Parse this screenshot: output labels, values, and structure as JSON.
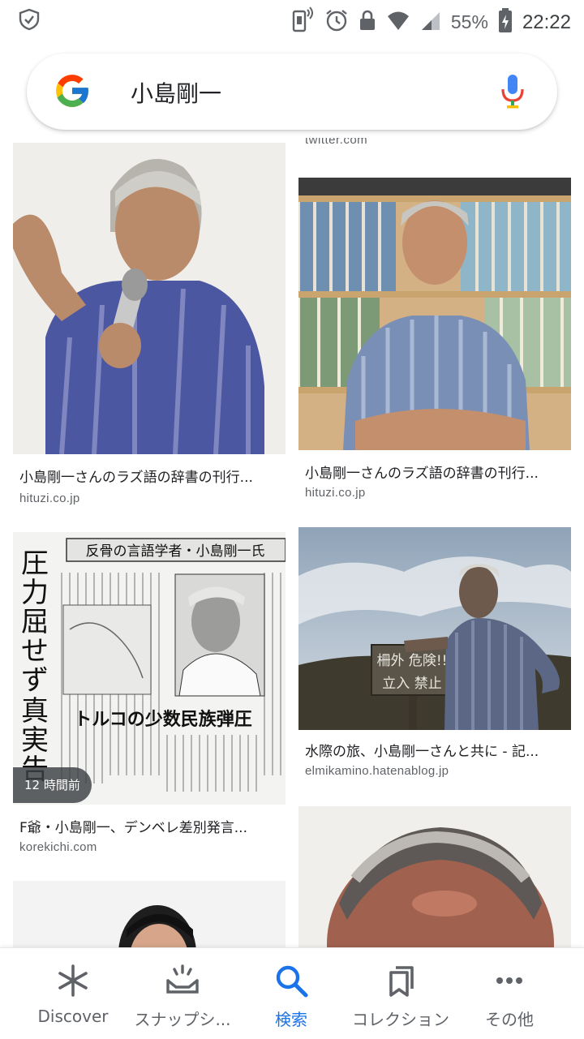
{
  "status_bar": {
    "battery_percent": "55%",
    "time": "22:22"
  },
  "search": {
    "query": "小島剛一"
  },
  "results": {
    "cut_domain": "twitter.com",
    "items": [
      {
        "title": "小島剛一さんのラズ語の辞書の刊行...",
        "domain": "hituzi.co.jp"
      },
      {
        "title": "小島剛一さんのラズ語の辞書の刊行...",
        "domain": "hituzi.co.jp"
      },
      {
        "title": "F爺・小島剛一、デンベレ差別発言...",
        "domain": "korekichi.com",
        "badge": "12 時間前"
      },
      {
        "title": "水際の旅、小島剛一さんと共に - 記...",
        "domain": "elmikamino.hatenablog.jp"
      }
    ],
    "newspaper": {
      "headline": "反骨の言語学者・小島剛一氏",
      "vertical": "圧力屈せず 真実告発",
      "subhead": "トルコの少数民族弾圧"
    },
    "sign": {
      "line1": "柵外 危険!!",
      "line2": "立入 禁止"
    }
  },
  "bottom_nav": {
    "items": [
      {
        "label": "Discover",
        "icon": "discover-icon"
      },
      {
        "label": "スナップシ...",
        "icon": "snapshot-icon"
      },
      {
        "label": "検索",
        "icon": "search-icon",
        "active": true
      },
      {
        "label": "コレクション",
        "icon": "collections-icon"
      },
      {
        "label": "その他",
        "icon": "more-icon"
      }
    ]
  },
  "colors": {
    "accent": "#1a73e8",
    "text": "#202124",
    "secondary_text": "#5f6368"
  }
}
